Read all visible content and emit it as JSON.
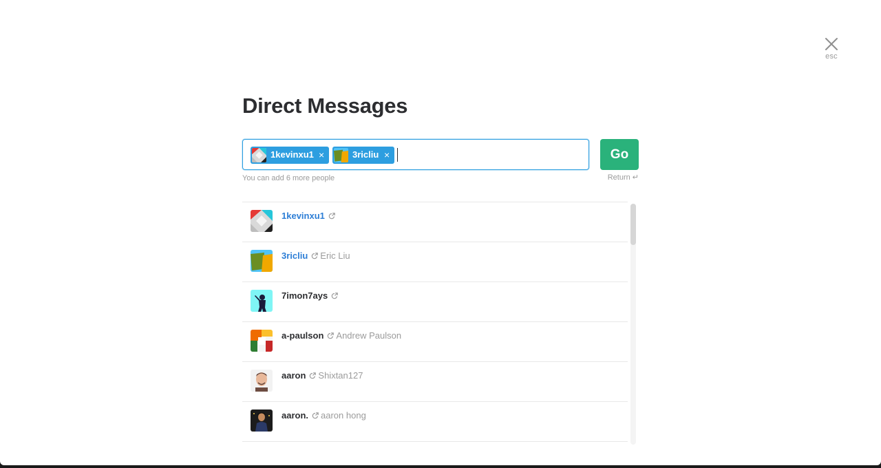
{
  "dialog": {
    "title": "Direct Messages",
    "close_hint": "esc"
  },
  "input": {
    "tokens": [
      {
        "label": "1kevinxu1",
        "remove_glyph": "×"
      },
      {
        "label": "3ricliu",
        "remove_glyph": "×"
      }
    ],
    "hint": "You can add 6 more people"
  },
  "go_button": {
    "label": "Go",
    "hint": "Return ↵"
  },
  "results": [
    {
      "username": "1kevinxu1",
      "real_name": "",
      "selected": true,
      "avatar": "red-white-black-tiles"
    },
    {
      "username": "3ricliu",
      "real_name": "Eric Liu",
      "selected": true,
      "avatar": "green-orange-tiles"
    },
    {
      "username": "7imon7ays",
      "real_name": "",
      "selected": false,
      "avatar": "silhouette-cyan"
    },
    {
      "username": "a-paulson",
      "real_name": "Andrew Paulson",
      "selected": false,
      "avatar": "orange-green-tiles"
    },
    {
      "username": "aaron",
      "real_name": "Shixtan127",
      "selected": false,
      "avatar": "man-photo"
    },
    {
      "username": "aaron.",
      "real_name": "aaron hong",
      "selected": false,
      "avatar": "person-dark-photo"
    }
  ],
  "colors": {
    "accent_blue": "#2d9ee0",
    "link_blue": "#2d7ed6",
    "go_green": "#2ab27b"
  },
  "icons": {
    "close": "close-x-icon",
    "external_member": "external-link-icon"
  }
}
